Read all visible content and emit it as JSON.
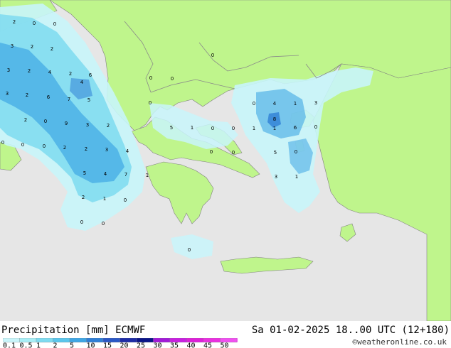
{
  "header": {
    "title": "Precipitation [mm] ECMWF",
    "datetime": "Sa 01-02-2025 18..00 UTC (12+180)",
    "credit": "©weatheronline.co.uk"
  },
  "legend": {
    "labels": [
      "0.1",
      "0.5",
      "1",
      "2",
      "5",
      "10",
      "15",
      "20",
      "25",
      "30",
      "35",
      "40",
      "45",
      "50"
    ],
    "colors": [
      "#c8f5fa",
      "#a7eef6",
      "#7edbf0",
      "#5bc6ec",
      "#3fa6e4",
      "#2f7fd6",
      "#2a58c6",
      "#1d2ca6",
      "#0a1488",
      "#a21ad8",
      "#c81fe0",
      "#dd20d8",
      "#ea30e0",
      "#f050f0"
    ]
  },
  "map": {
    "colors": {
      "sea": "#e6e6e6",
      "land": "#bff58c",
      "border": "#8a8a8a",
      "coast": "#808080"
    },
    "values": [
      {
        "label": "2"
      },
      {
        "label": "0"
      },
      {
        "label": "0"
      },
      {
        "label": "3"
      },
      {
        "label": "2"
      },
      {
        "label": "2"
      },
      {
        "label": "3"
      },
      {
        "label": "2"
      },
      {
        "label": "4"
      },
      {
        "label": "2"
      },
      {
        "label": "6"
      },
      {
        "label": "4"
      },
      {
        "label": "3"
      },
      {
        "label": "2"
      },
      {
        "label": "6"
      },
      {
        "label": "7"
      },
      {
        "label": "5"
      },
      {
        "label": "2"
      },
      {
        "label": "0"
      },
      {
        "label": "9"
      },
      {
        "label": "3"
      },
      {
        "label": "2"
      },
      {
        "label": "0"
      },
      {
        "label": "0"
      },
      {
        "label": "0"
      },
      {
        "label": "2"
      },
      {
        "label": "2"
      },
      {
        "label": "3"
      },
      {
        "label": "4"
      },
      {
        "label": "5"
      },
      {
        "label": "4"
      },
      {
        "label": "7"
      },
      {
        "label": "1"
      },
      {
        "label": "2"
      },
      {
        "label": "1"
      },
      {
        "label": "0"
      },
      {
        "label": "0"
      },
      {
        "label": "0"
      },
      {
        "label": "0"
      },
      {
        "label": "0"
      },
      {
        "label": "0"
      },
      {
        "label": "0"
      },
      {
        "label": "5"
      },
      {
        "label": "1"
      },
      {
        "label": "0"
      },
      {
        "label": "0"
      },
      {
        "label": "0"
      },
      {
        "label": "1"
      },
      {
        "label": "4"
      },
      {
        "label": "1"
      },
      {
        "label": "3"
      },
      {
        "label": "1"
      },
      {
        "label": "8"
      },
      {
        "label": "6"
      },
      {
        "label": "0"
      },
      {
        "label": "0"
      },
      {
        "label": "0"
      },
      {
        "label": "5"
      },
      {
        "label": "0"
      },
      {
        "label": "3"
      },
      {
        "label": "1"
      },
      {
        "label": "0"
      }
    ]
  }
}
